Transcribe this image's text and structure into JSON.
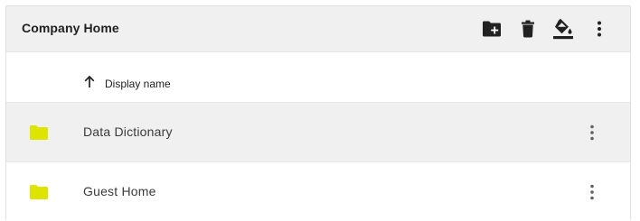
{
  "toolbar": {
    "title": "Company Home",
    "actions": [
      {
        "icon": "create-folder-icon"
      },
      {
        "icon": "delete-icon"
      },
      {
        "icon": "paint-bucket-icon"
      },
      {
        "icon": "more-vert-icon"
      }
    ]
  },
  "table": {
    "column_header": "Display name",
    "sort_direction": "ascending",
    "rows": [
      {
        "name": "Data Dictionary",
        "icon": "folder-icon"
      },
      {
        "name": "Guest Home",
        "icon": "folder-icon"
      }
    ]
  },
  "colors": {
    "folder": "#dce400",
    "toolbar_bg": "#f0f0f0",
    "selected_row_bg": "#f0f0f0",
    "icon": "#212121"
  }
}
